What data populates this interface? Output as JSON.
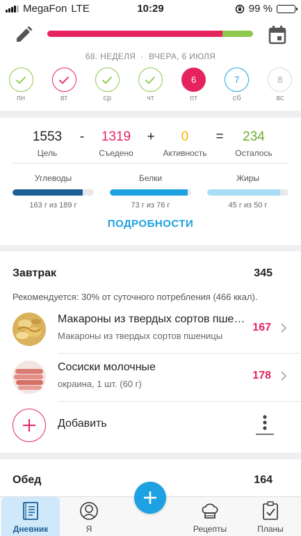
{
  "status_bar": {
    "carrier": "MegaFon",
    "network": "LTE",
    "time": "10:29",
    "battery": "99 %",
    "battery_level": 0.99
  },
  "header": {
    "week_label": "68. НЕДЕЛЯ",
    "separator": "·",
    "date_label": "ВЧЕРА, 6 ИЮЛЯ",
    "progress_eaten_fraction": 0.853,
    "colors": {
      "eaten": "#e5245e",
      "remaining": "#8cc84b"
    }
  },
  "days": [
    {
      "label": "пн",
      "state": "done",
      "value": ""
    },
    {
      "label": "вт",
      "state": "over",
      "value": ""
    },
    {
      "label": "ср",
      "state": "done",
      "value": ""
    },
    {
      "label": "чт",
      "state": "done",
      "value": ""
    },
    {
      "label": "пт",
      "state": "today",
      "value": "6"
    },
    {
      "label": "сб",
      "state": "future1",
      "value": "7"
    },
    {
      "label": "вс",
      "state": "future2",
      "value": "8"
    }
  ],
  "summary": {
    "goal": {
      "value": "1553",
      "label": "Цель"
    },
    "minus": "-",
    "eaten": {
      "value": "1319",
      "label": "Съедено"
    },
    "plus": "+",
    "activity": {
      "value": "0",
      "label": "Активность"
    },
    "equals": "=",
    "remaining": {
      "value": "234",
      "label": "Осталось"
    },
    "colors": {
      "eaten": "#e5245e",
      "activity": "#f5b800",
      "remaining": "#6aab2e"
    }
  },
  "macros": [
    {
      "name": "Углеводы",
      "value": "163 г из 189 г",
      "fraction": 0.862,
      "color": "#1d5e96"
    },
    {
      "name": "Белки",
      "value": "73 г из 76 г",
      "fraction": 0.96,
      "color": "#1da1e2"
    },
    {
      "name": "Жиры",
      "value": "45 г из 50 г",
      "fraction": 0.9,
      "color": "#a9dcf5"
    }
  ],
  "details_label": "ПОДРОБНОСТИ",
  "breakfast": {
    "title": "Завтрак",
    "total": "345",
    "recommendation": "Рекомендуется: 30% от суточного потребления (466 ккал).",
    "items": [
      {
        "title": "Макароны из твердых сортов пшеницы",
        "subtitle": "Макароны из твердых сортов пшеницы",
        "kcal": "167",
        "icon": "pasta-photo"
      },
      {
        "title": "Сосиски молочные",
        "subtitle": "окраина, 1 шт. (60 г)",
        "kcal": "178",
        "icon": "sausage-photo"
      }
    ],
    "add_label": "Добавить"
  },
  "lunch": {
    "title": "Обед",
    "total": "164"
  },
  "tabs": [
    {
      "label": "Дневник",
      "icon": "diary-icon",
      "active": true
    },
    {
      "label": "Я",
      "icon": "profile-icon",
      "active": false
    },
    {
      "label": "Рецепты",
      "icon": "chef-hat-icon",
      "active": false
    },
    {
      "label": "Планы",
      "icon": "clipboard-icon",
      "active": false
    }
  ]
}
